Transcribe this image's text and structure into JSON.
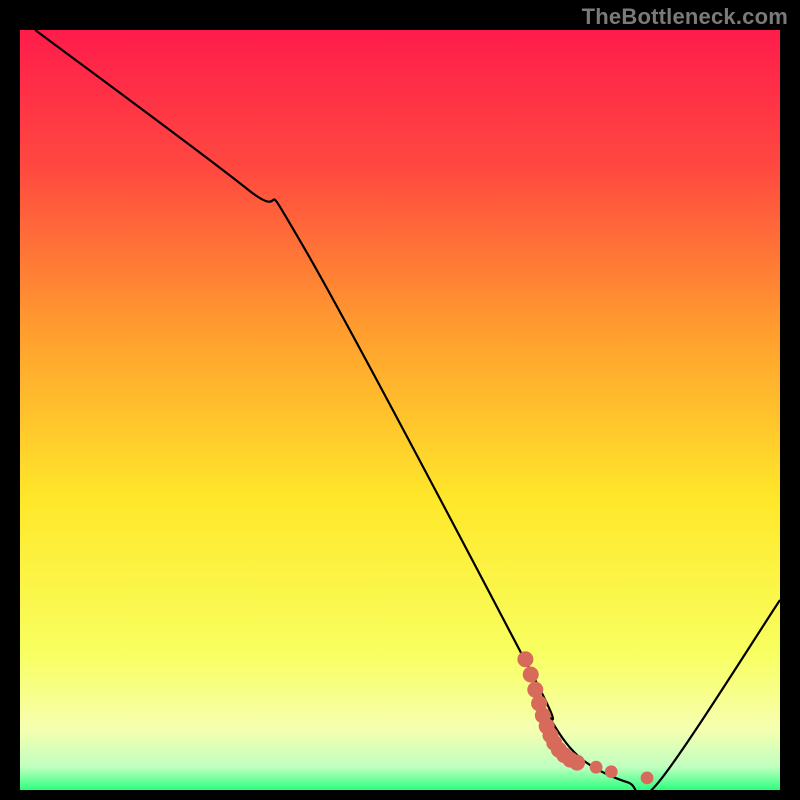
{
  "watermark": "TheBottleneck.com",
  "chart_data": {
    "type": "line",
    "title": "",
    "xlabel": "",
    "ylabel": "",
    "xlim": [
      0,
      100
    ],
    "ylim": [
      0,
      100
    ],
    "grid": false,
    "legend": false,
    "gradient_stops": [
      {
        "offset": 0.0,
        "color": "#ff1c4b"
      },
      {
        "offset": 0.18,
        "color": "#ff4840"
      },
      {
        "offset": 0.4,
        "color": "#ff9f2e"
      },
      {
        "offset": 0.62,
        "color": "#ffe82a"
      },
      {
        "offset": 0.82,
        "color": "#f8ff60"
      },
      {
        "offset": 0.92,
        "color": "#f6ffb0"
      },
      {
        "offset": 0.97,
        "color": "#bfffc0"
      },
      {
        "offset": 1.0,
        "color": "#2dff7e"
      }
    ],
    "series": [
      {
        "name": "bottleneck-curve",
        "x": [
          2,
          30,
          37,
          67,
          70,
          74,
          80,
          84,
          100
        ],
        "y": [
          100,
          79,
          72,
          16,
          9,
          4,
          1,
          1,
          25
        ]
      }
    ],
    "highlight_points": {
      "name": "sweet-spot",
      "color": "#d86a5c",
      "points": [
        {
          "x": 66.5,
          "y": 17.2,
          "r": 5
        },
        {
          "x": 67.2,
          "y": 15.2,
          "r": 5
        },
        {
          "x": 67.8,
          "y": 13.2,
          "r": 5
        },
        {
          "x": 68.3,
          "y": 11.4,
          "r": 5
        },
        {
          "x": 68.8,
          "y": 9.8,
          "r": 5
        },
        {
          "x": 69.3,
          "y": 8.4,
          "r": 5
        },
        {
          "x": 69.8,
          "y": 7.2,
          "r": 5
        },
        {
          "x": 70.3,
          "y": 6.2,
          "r": 5
        },
        {
          "x": 70.9,
          "y": 5.3,
          "r": 5
        },
        {
          "x": 71.6,
          "y": 4.6,
          "r": 5
        },
        {
          "x": 72.4,
          "y": 4.0,
          "r": 5
        },
        {
          "x": 73.3,
          "y": 3.6,
          "r": 5
        },
        {
          "x": 75.8,
          "y": 3.0,
          "r": 4
        },
        {
          "x": 77.8,
          "y": 2.4,
          "r": 4
        },
        {
          "x": 82.5,
          "y": 1.6,
          "r": 4
        }
      ]
    }
  }
}
